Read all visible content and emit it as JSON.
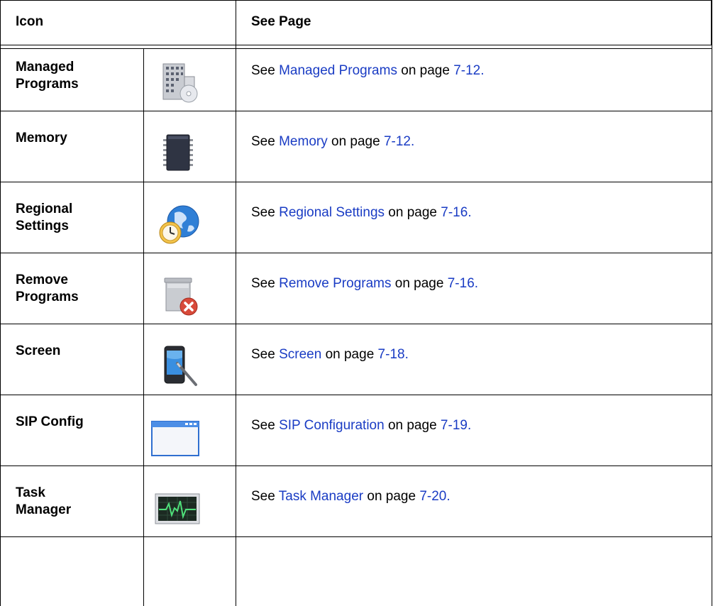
{
  "header": {
    "col_icon": "Icon",
    "col_see_page": "See Page"
  },
  "rows": [
    {
      "name": "Managed\nPrograms",
      "icon": "managed-programs-icon",
      "prefix": "See ",
      "link": "Managed Programs",
      "mid": " on page ",
      "page": "7-12",
      "suffix": "."
    },
    {
      "name": "Memory",
      "icon": "memory-chip-icon",
      "prefix": "See ",
      "link": "Memory",
      "mid": " on page ",
      "page": "7-12",
      "suffix": "."
    },
    {
      "name": "Regional\nSettings",
      "icon": "globe-clock-icon",
      "prefix": "See ",
      "link": "Regional Settings",
      "mid": " on page ",
      "page": "7-16",
      "suffix": "."
    },
    {
      "name": "Remove\nPrograms",
      "icon": "remove-programs-icon",
      "prefix": "See ",
      "link": "Remove Programs",
      "mid": " on page ",
      "page": "7-16",
      "suffix": "."
    },
    {
      "name": "Screen",
      "icon": "screen-stylus-icon",
      "prefix": "See ",
      "link": "Screen",
      "mid": " on page ",
      "page": "7-18",
      "suffix": "."
    },
    {
      "name": "SIP Config",
      "icon": "window-icon",
      "prefix": "See ",
      "link": "SIP Configuration",
      "mid": " on page ",
      "page": "7-19",
      "suffix": "."
    },
    {
      "name": "Task\nManager",
      "icon": "task-manager-icon",
      "prefix": "See ",
      "link": "Task Manager",
      "mid": " on page ",
      "page": "7-20",
      "suffix": "."
    }
  ],
  "colors": {
    "link": "#1a3cc4",
    "border": "#000000"
  }
}
